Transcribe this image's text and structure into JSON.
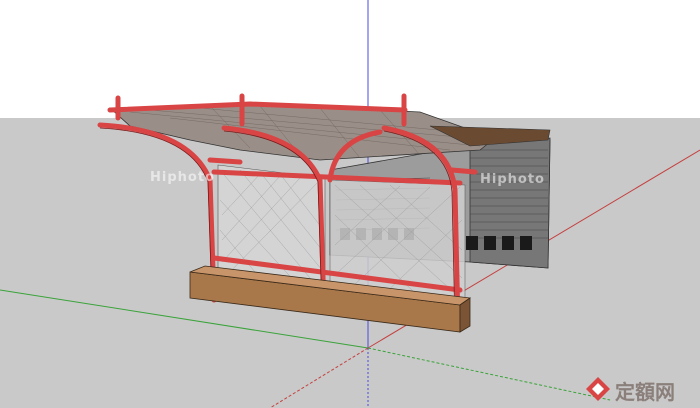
{
  "scene": {
    "sky_color": "#ffffff",
    "ground_color": "#c9c9c9",
    "axis_red": "#c64040",
    "axis_green": "#3aa33a",
    "axis_blue": "#4a4ae0",
    "frame_red": "#d94545",
    "roof_color": "#9a8f88",
    "bench_wood": "#a9784a",
    "panel_gray": "#8a8a8a"
  },
  "watermarks": {
    "hiphoto_left": "Hiphoto",
    "hiphoto_right": "Hiphoto"
  },
  "logo": {
    "text": "定額网"
  }
}
